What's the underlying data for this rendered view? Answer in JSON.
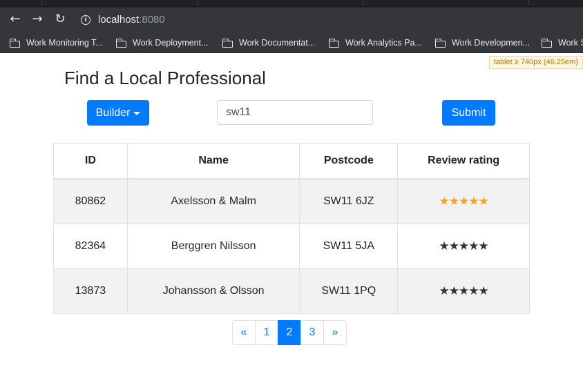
{
  "browser": {
    "url_host": "localhost",
    "url_port": ":8080",
    "bookmarks": [
      "Work Monitoring T...",
      "Work Deployment...",
      "Work Documentat...",
      "Work Analytics Pa...",
      "Work Developmen...",
      "Work S"
    ]
  },
  "dev_badge": "tablet ≥ 740px (46.25em)",
  "page_title": "Find a Local Professional",
  "form": {
    "profession_label": "Builder",
    "search_value": "sw11",
    "submit_label": "Submit"
  },
  "table": {
    "headers": [
      "ID",
      "Name",
      "Postcode",
      "Review rating"
    ],
    "rows": [
      {
        "id": "80862",
        "name": "Axelsson & Malm",
        "postcode": "SW11 6JZ",
        "stars": "★★★★★",
        "rating_color": "#f5a623"
      },
      {
        "id": "82364",
        "name": "Berggren Nilsson",
        "postcode": "SW11 5JA",
        "stars": "★★★★★",
        "rating_color": "#333333"
      },
      {
        "id": "13873",
        "name": "Johansson & Olsson",
        "postcode": "SW11 1PQ",
        "stars": "★★★★★",
        "rating_color": "#333333"
      }
    ]
  },
  "pagination": {
    "prev": "«",
    "pages": [
      "1",
      "2",
      "3"
    ],
    "active": "2",
    "next": "»"
  },
  "colors": {
    "primary": "#007bff",
    "gold_star": "#f5a623",
    "dark_star": "#333333"
  }
}
